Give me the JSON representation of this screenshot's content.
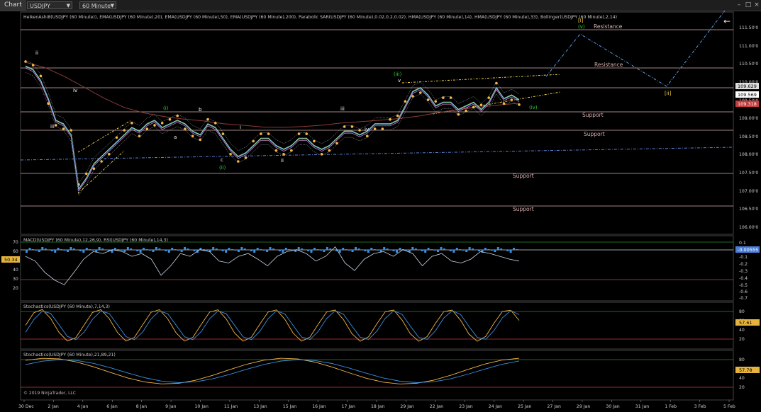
{
  "toolbar": {
    "chart_label": "Chart",
    "instrument": "USDJPY",
    "interval": "60 Minute"
  },
  "footer": {
    "copyright": "© 2019 NinjaTrader, LLC"
  },
  "colors": {
    "background": "#000000",
    "price_highlight": "#ffffff",
    "resistance_line": "#d9b1b1",
    "support_line": "#d9b1b1",
    "ema20": "#5fb0ff",
    "ema200": "#8b3a3a",
    "parabolic_sar": "#f3b645",
    "wave_label_green": "#32d232",
    "wave_label_yellow": "#f3d04a"
  },
  "chart_data": [
    {
      "type": "line",
      "name": "price",
      "indicator_legend": "HeikenAshi8(USDJPY (60 Minute)), EMA(USDJPY (60 Minute),20), EMA(USDJPY (60 Minute),50), EMA(USDJPY (60 Minute),200), Parabolic SAR(USDJPY (60 Minute),0.02,0.2,0.02), HMA(USDJPY (60 Minute),14), HMA(USDJPY (60 Minute),33), Bollinger(USDJPY (60 Minute),2,14)",
      "x_ticks": [
        "30 Dec",
        "2 Jan",
        "4 Jan",
        "6 Jan",
        "8 Jan",
        "9 Jan",
        "10 Jan",
        "11 Jan",
        "13 Jan",
        "15 Jan",
        "16 Jan",
        "17 Jan",
        "18 Jan",
        "29 Jan",
        "22 Jan",
        "23 Jan",
        "24 Jan",
        "25 Jan",
        "27 Jan",
        "29 Jan",
        "30 Jan",
        "31 Jan",
        "1 Feb",
        "3 Feb",
        "5 Feb"
      ],
      "y_ticks": [
        "111.50'0",
        "111.00'0",
        "110.50'0",
        "110.00'0",
        "109.50'0",
        "109.00'0",
        "108.50'0",
        "108.00'0",
        "107.50'0",
        "107.00'0",
        "106.50'0",
        "106.00'0"
      ],
      "ylim": [
        105.7,
        111.75
      ],
      "price_labels": {
        "high": "109.629",
        "last": "109.569",
        "low": "109.318"
      },
      "levels": [
        {
          "label": "Resistance",
          "value": 111.4
        },
        {
          "label": "Resistance",
          "value": 110.33
        },
        {
          "label": "",
          "value": 109.87
        },
        {
          "label": "Support",
          "value": 109.07
        },
        {
          "label": "Support",
          "value": 108.57
        },
        {
          "label": "Support",
          "value": 107.32
        },
        {
          "label": "Support",
          "value": 106.4
        }
      ],
      "series_close": [
        110.5,
        110.4,
        110.1,
        109.6,
        109.0,
        108.9,
        108.6,
        107.1,
        107.4,
        107.8,
        108.0,
        108.2,
        108.4,
        108.6,
        108.8,
        108.7,
        108.9,
        109.0,
        108.8,
        108.9,
        109.0,
        108.9,
        108.7,
        108.6,
        108.9,
        108.8,
        108.5,
        108.2,
        108.0,
        108.1,
        108.3,
        108.5,
        108.5,
        108.3,
        108.2,
        108.3,
        108.5,
        108.5,
        108.3,
        108.2,
        108.3,
        108.5,
        108.7,
        108.7,
        108.6,
        108.7,
        108.9,
        108.9,
        108.9,
        109.0,
        109.4,
        109.8,
        109.9,
        109.7,
        109.4,
        109.5,
        109.5,
        109.3,
        109.4,
        109.5,
        109.3,
        109.5,
        109.9,
        109.6,
        109.7,
        109.57
      ],
      "ema200": [
        110.6,
        110.45,
        110.2,
        109.9,
        109.6,
        109.35,
        109.2,
        109.1,
        109.03,
        108.98,
        108.9,
        108.86,
        108.81,
        108.8,
        108.82,
        108.86,
        108.92,
        108.96,
        109.0,
        109.05,
        109.12,
        109.22,
        109.3,
        109.36,
        109.42,
        109.47
      ],
      "wave_labels": [
        {
          "text": "ii",
          "color": "white"
        },
        {
          "text": "iii",
          "color": "white"
        },
        {
          "text": "iv",
          "color": "white"
        },
        {
          "text": "(i)",
          "color": "green"
        },
        {
          "text": "a",
          "color": "white"
        },
        {
          "text": "b",
          "color": "white"
        },
        {
          "text": "c",
          "color": "white"
        },
        {
          "text": "(ii)",
          "color": "green"
        },
        {
          "text": "i",
          "color": "white"
        },
        {
          "text": "ii",
          "color": "white"
        },
        {
          "text": "iii",
          "color": "white"
        },
        {
          "text": "iv",
          "color": "white"
        },
        {
          "text": "(iii)",
          "color": "green"
        },
        {
          "text": "v",
          "color": "white"
        },
        {
          "text": "(iv)",
          "color": "green"
        },
        {
          "text": "[i]",
          "color": "yellow"
        },
        {
          "text": "(v)",
          "color": "green"
        },
        {
          "text": "[ii]",
          "color": "yellow"
        }
      ],
      "projection": [
        {
          "date": "25 Jan",
          "price": 109.6
        },
        {
          "date": "28 Jan",
          "price": 111.2
        },
        {
          "date": "1 Feb",
          "price": 109.9
        },
        {
          "date": "5 Feb",
          "price": 111.8
        }
      ]
    },
    {
      "type": "line",
      "name": "macd_rsi",
      "indicator_legend": "MACD(USDJPY (60 Minute),12,26,9), RSI(USDJPY (60 Minute),14,3)",
      "y_ticks_left": [
        "70",
        "60",
        "50",
        "40",
        "30",
        "20"
      ],
      "y_ticks_right": [
        "0.1",
        "0",
        "-0.1",
        "-0.2",
        "-0.3",
        "-0.4",
        "-0.5",
        "-0.6",
        "-0.7"
      ],
      "value_label_left": "50.34",
      "value_label_right": "-0.00555",
      "rsi": [
        55,
        50,
        38,
        30,
        25,
        38,
        52,
        60,
        58,
        62,
        60,
        55,
        58,
        52,
        35,
        45,
        58,
        55,
        62,
        60,
        50,
        48,
        55,
        58,
        52,
        45,
        55,
        60,
        62,
        58,
        50,
        55,
        65,
        48,
        40,
        52,
        58,
        60,
        55,
        62,
        58,
        45,
        55,
        58,
        50,
        48,
        52,
        60,
        58,
        55,
        52,
        50
      ]
    },
    {
      "type": "line",
      "name": "stochastics_fast",
      "indicator_legend": "Stochastics(USDJPY (60 Minute),7,14,3)",
      "y_ticks": [
        "80",
        "60",
        "40",
        "20"
      ],
      "value_label": "57.61"
    },
    {
      "type": "line",
      "name": "stochastics_slow",
      "indicator_legend": "Stochastics(USDJPY (60 Minute),21,89,21)",
      "y_ticks": [
        "80",
        "60",
        "40",
        "20"
      ],
      "value_label": "57.78"
    }
  ]
}
